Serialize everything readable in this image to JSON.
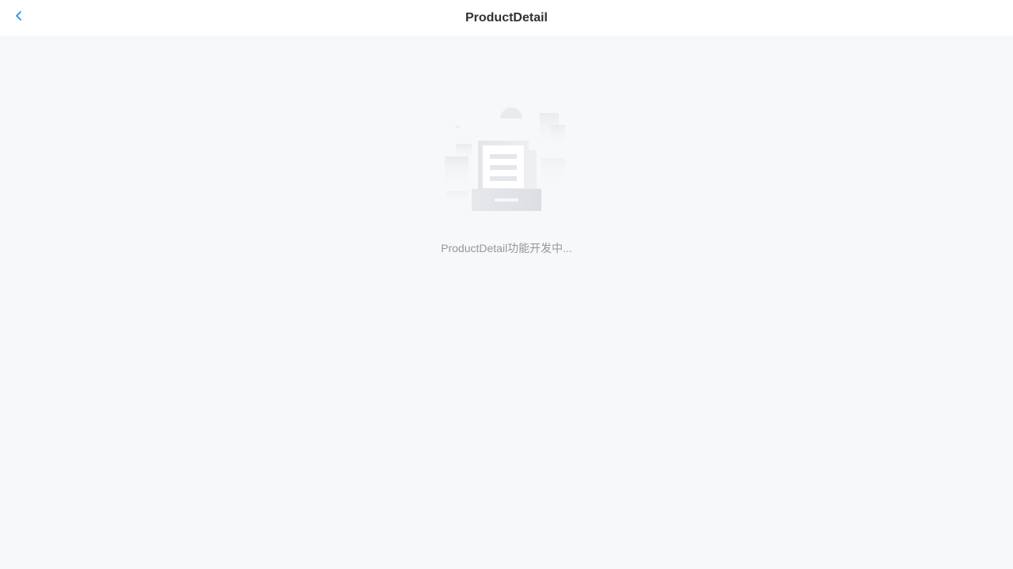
{
  "nav": {
    "title": "ProductDetail",
    "back_icon": "chevron-left-icon",
    "accent_color": "#1989fa"
  },
  "empty_state": {
    "illustration": "empty-document-icon",
    "description": "ProductDetail功能开发中..."
  }
}
